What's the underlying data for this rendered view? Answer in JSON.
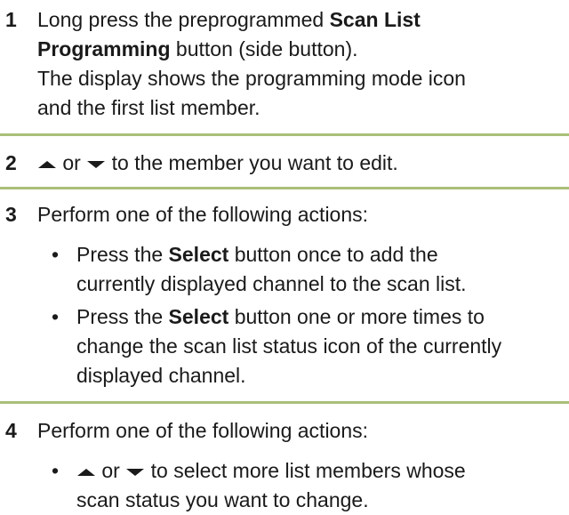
{
  "steps": [
    {
      "number": "1",
      "line1_pre": "Long press the preprogrammed ",
      "line1_bold": "Scan List",
      "line2_bold": "Programming",
      "line2_post": " button (side button).",
      "line3": "The display shows the programming mode icon",
      "line4": "and the first list member."
    },
    {
      "number": "2",
      "or_text": " or ",
      "post_text": " to the member you want to edit."
    },
    {
      "number": "3",
      "intro": "Perform one of the following actions:",
      "bullets": [
        {
          "pre": "Press the ",
          "bold": "Select",
          "post": " button once to add the",
          "line2": "currently displayed channel to the scan list."
        },
        {
          "pre": "Press the ",
          "bold": "Select",
          "post": " button one or more times to",
          "line2": "change the scan list status icon of the currently",
          "line3": "displayed channel."
        }
      ]
    },
    {
      "number": "4",
      "intro": "Perform one of the following actions:",
      "bullet_or_text": " or ",
      "bullet_post": " to select more list members whose",
      "bullet_line2": "scan status you want to change."
    }
  ],
  "bullet_char": "•",
  "icons": [
    "up-arrow-icon",
    "down-arrow-icon"
  ],
  "colors": {
    "divider": "#a9bf79",
    "text": "#1a1a1a"
  }
}
